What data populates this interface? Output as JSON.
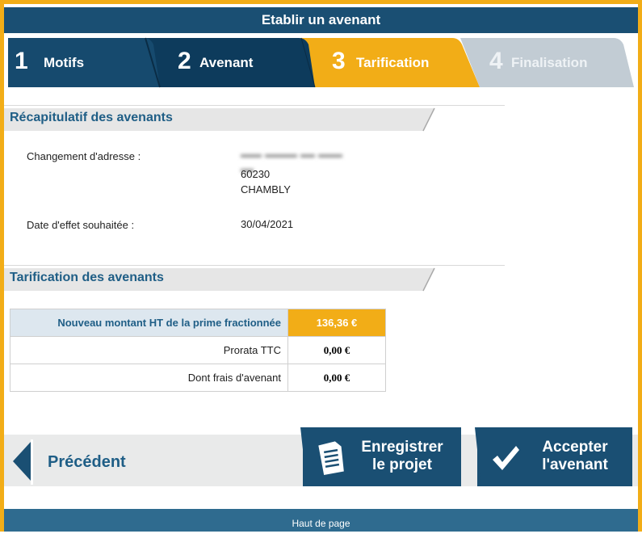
{
  "header": {
    "title": "Etablir un avenant"
  },
  "steps": [
    {
      "num": "1",
      "label": "Motifs"
    },
    {
      "num": "2",
      "label": "Avenant"
    },
    {
      "num": "3",
      "label": "Tarification"
    },
    {
      "num": "4",
      "label": "Finalisation"
    }
  ],
  "recap": {
    "title": "Récapitulatif des avenants",
    "address_label": "Changement d'adresse :",
    "postal_code": "60230",
    "city": "CHAMBLY",
    "date_label": "Date d'effet souhaitée :",
    "date_value": "30/04/2021"
  },
  "tarif": {
    "title": "Tarification des avenants",
    "rows": [
      {
        "label": "Nouveau montant HT de la prime fractionnée",
        "value": "136,36 €"
      },
      {
        "label": "Prorata TTC",
        "value": "0,00 €"
      },
      {
        "label": "Dont frais d'avenant",
        "value": "0,00 €"
      }
    ]
  },
  "nav": {
    "prev_label": "Précédent",
    "save_line1": "Enregistrer",
    "save_line2": "le projet",
    "accept_line1": "Accepter",
    "accept_line2": "l'avenant"
  },
  "footer": {
    "top_link": "Haut de page"
  },
  "colors": {
    "accent": "#f2ad17",
    "primary": "#1a4f73",
    "text_blue": "#1f5e86"
  }
}
